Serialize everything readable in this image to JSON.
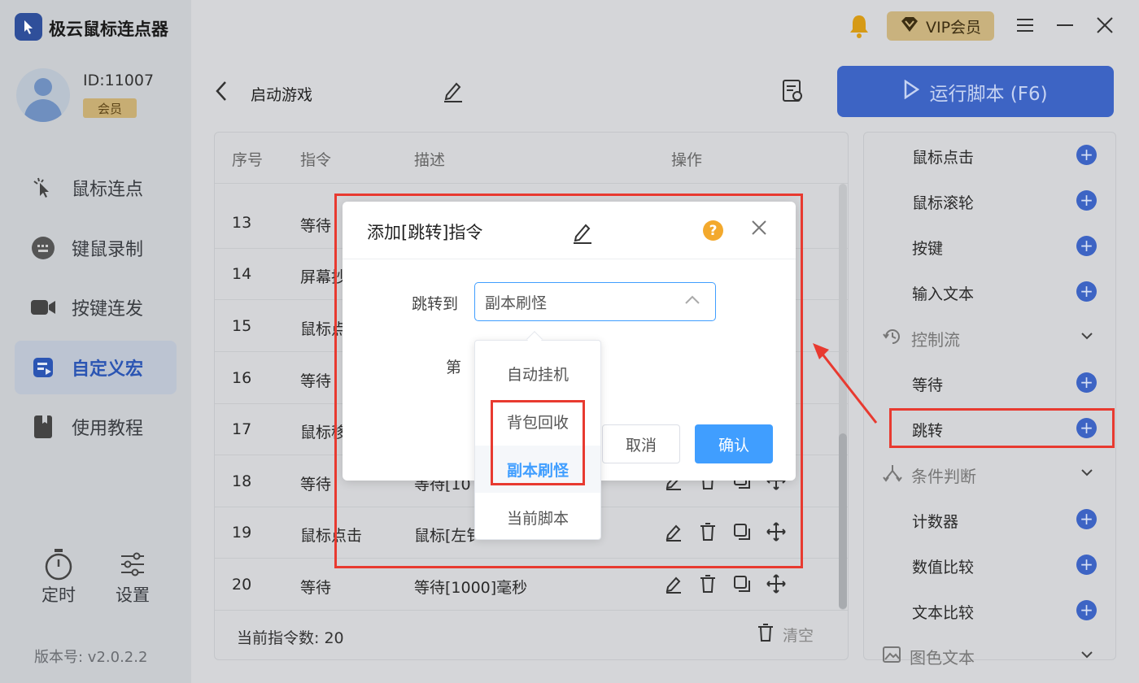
{
  "app": {
    "title": "极云鼠标连点器",
    "user_id": "ID:11007",
    "member_badge": "会员",
    "vip_label": "VIP会员",
    "version": "版本号: v2.0.2.2"
  },
  "nav": {
    "items": [
      {
        "label": "鼠标连点",
        "icon": "pointer-click-icon"
      },
      {
        "label": "键鼠录制",
        "icon": "keyboard-mouse-record-icon"
      },
      {
        "label": "按键连发",
        "icon": "video-camera-icon"
      },
      {
        "label": "自定义宏",
        "icon": "macro-icon",
        "active": true
      },
      {
        "label": "使用教程",
        "icon": "book-icon"
      }
    ],
    "timer_label": "定时",
    "settings_label": "设置"
  },
  "editor": {
    "macro_name": "启动游戏",
    "run_label": "运行脚本 (F6)"
  },
  "table": {
    "headers": [
      "序号",
      "指令",
      "描述",
      "操作"
    ],
    "rows": [
      {
        "no": "13",
        "cmd": "等待",
        "desc": ""
      },
      {
        "no": "14",
        "cmd": "屏幕抄",
        "desc": ""
      },
      {
        "no": "15",
        "cmd": "鼠标点",
        "desc": ""
      },
      {
        "no": "16",
        "cmd": "等待",
        "desc": ""
      },
      {
        "no": "17",
        "cmd": "鼠标移",
        "desc": ""
      },
      {
        "no": "18",
        "cmd": "等待",
        "desc": "等待[10"
      },
      {
        "no": "19",
        "cmd": "鼠标点击",
        "desc": "鼠标[左钅"
      },
      {
        "no": "20",
        "cmd": "等待",
        "desc": "等待[1000]毫秒"
      }
    ],
    "count_label": "当前指令数: 20",
    "clear_label": "清空"
  },
  "right_panel": {
    "items_top": [
      "鼠标点击",
      "鼠标滚轮",
      "按键",
      "输入文本"
    ],
    "group_control": "控制流",
    "items_control": [
      "等待",
      "跳转"
    ],
    "group_condition": "条件判断",
    "items_condition": [
      "计数器",
      "数值比较",
      "文本比较"
    ],
    "group_color": "图色文本"
  },
  "dialog": {
    "title": "添加[跳转]指令",
    "jump_to_label": "跳转到",
    "selected_value": "副本刷怪",
    "second_label": "第",
    "cancel": "取消",
    "confirm": "确认",
    "help": "?",
    "options": [
      "自动挂机",
      "背包回收",
      "副本刷怪",
      "当前脚本"
    ]
  },
  "colors": {
    "accent": "#409eff",
    "brand": "#3d64c4",
    "highlight_box": "#e83a30"
  }
}
